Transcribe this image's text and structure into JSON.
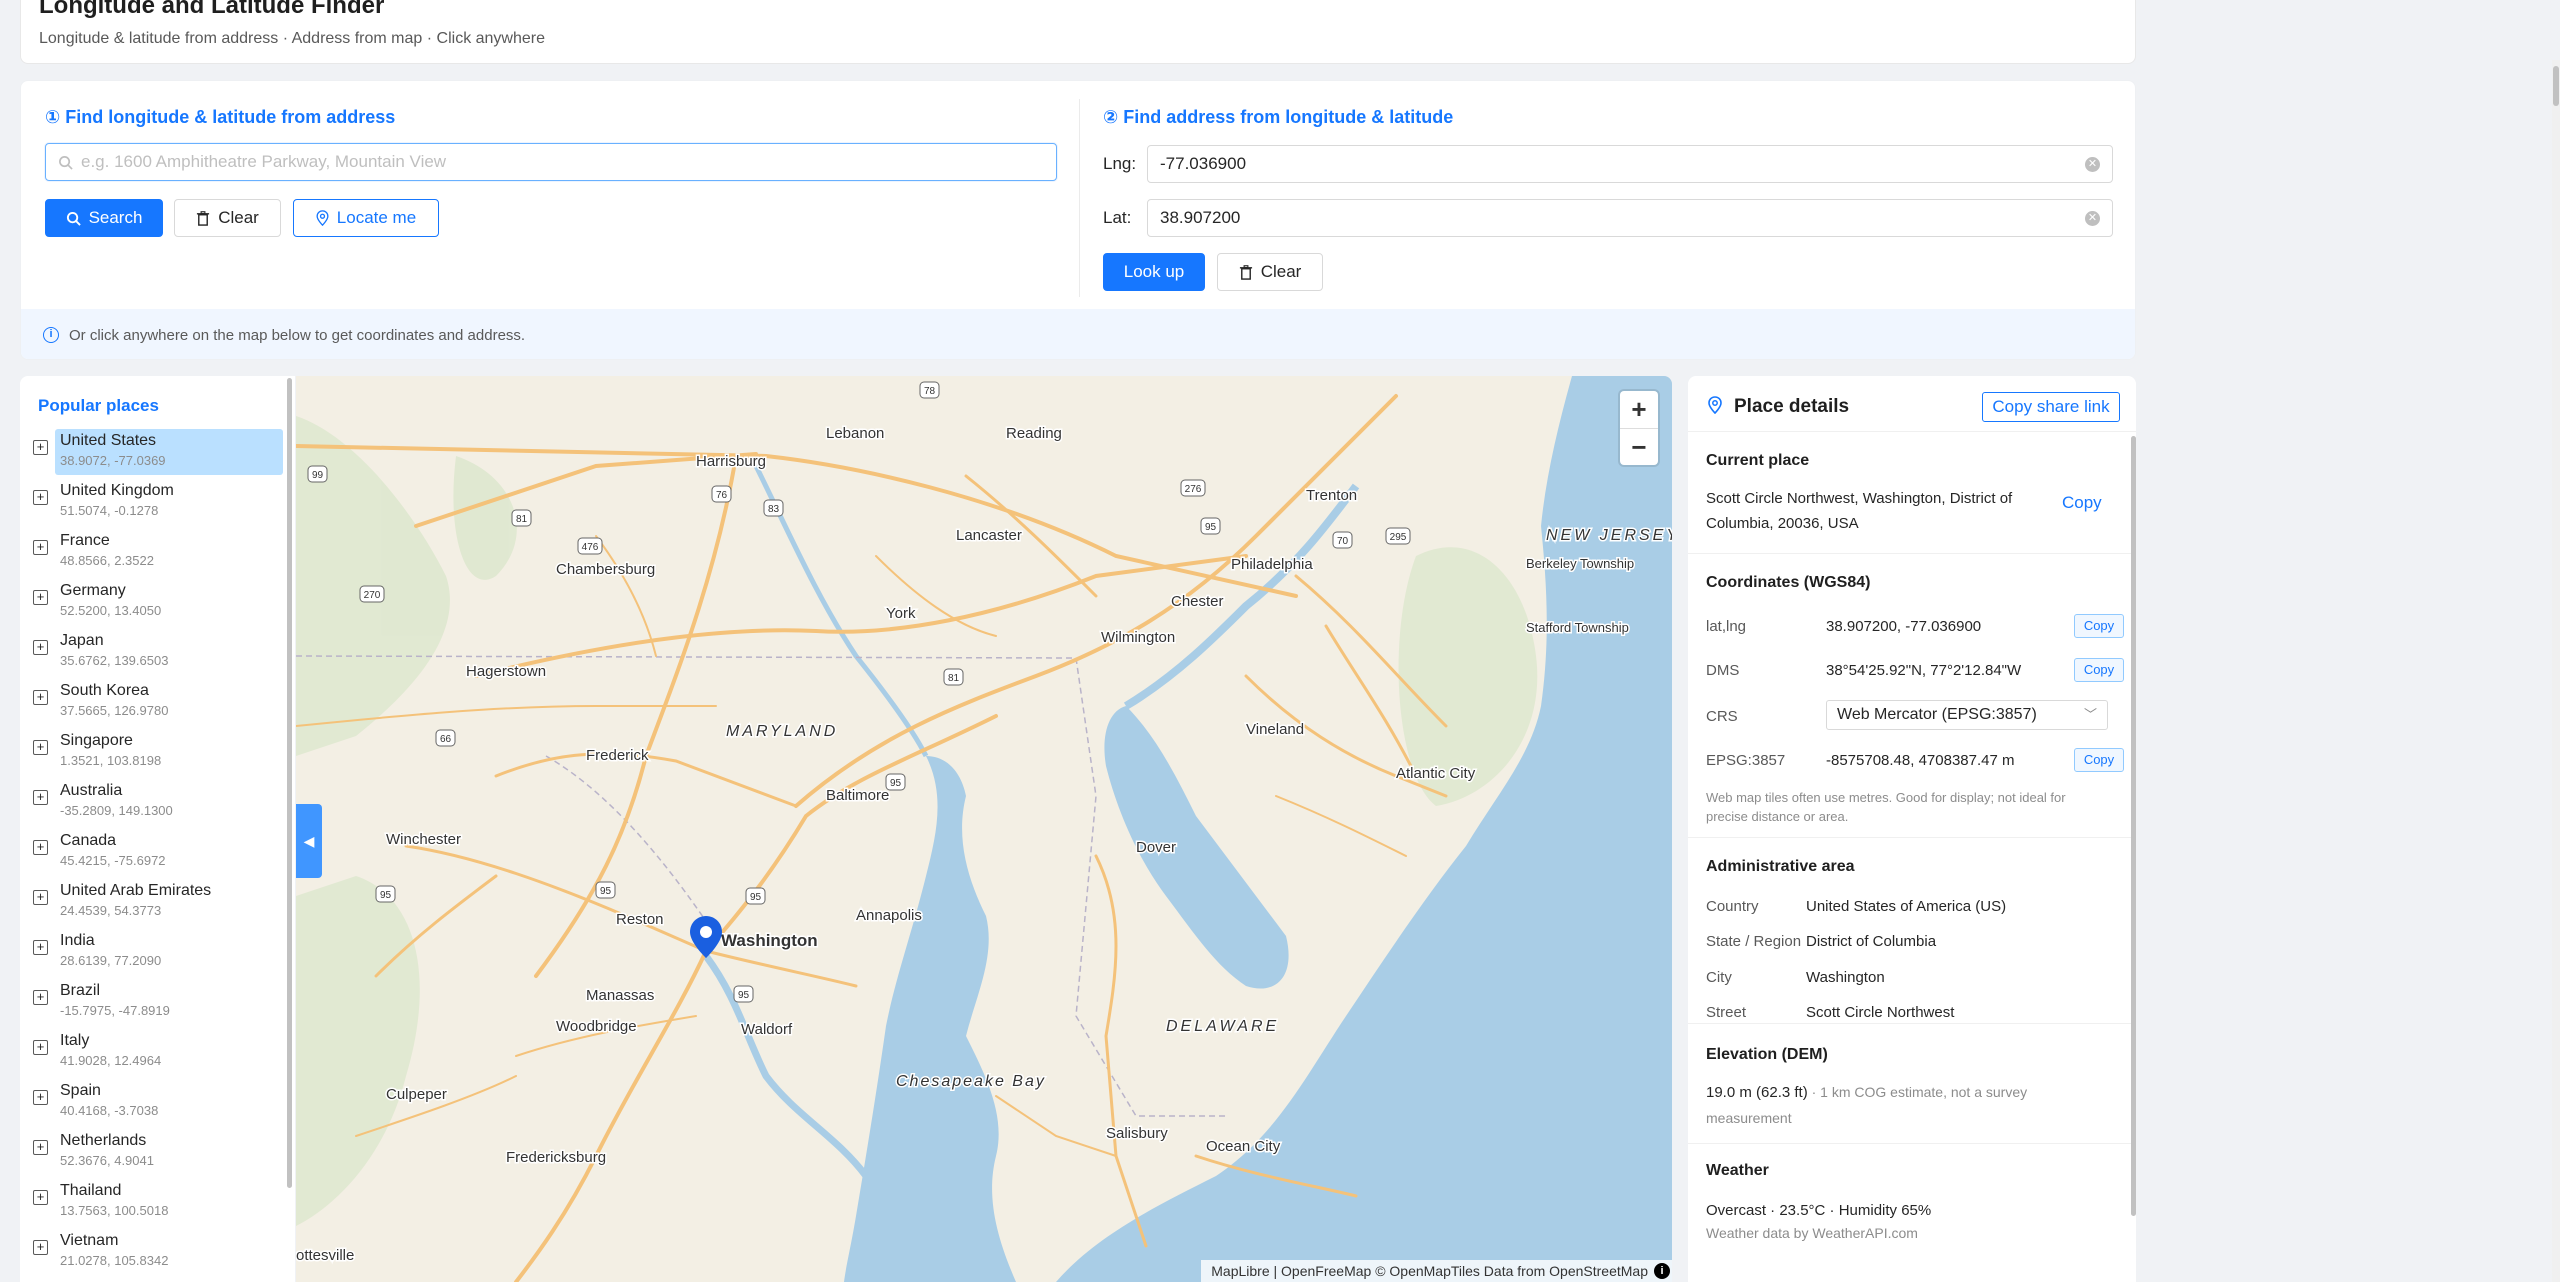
{
  "header": {
    "title": "Longitude and Latitude Finder",
    "subtitle": "Longitude & latitude from address · Address from map · Click anywhere"
  },
  "search": {
    "section1_title": "① Find longitude & latitude from address",
    "address_placeholder": "e.g. 1600 Amphitheatre Parkway, Mountain View",
    "search_label": "Search",
    "clear_label": "Clear",
    "locate_label": "Locate me",
    "section2_title": "② Find address from longitude & latitude",
    "lng_label": "Lng:",
    "lng_value": "-77.036900",
    "lat_label": "Lat:",
    "lat_value": "38.907200",
    "lookup_label": "Look up",
    "clear2_label": "Clear",
    "hint": "Or click anywhere on the map below to get coordinates and address."
  },
  "places": {
    "title": "Popular places",
    "items": [
      {
        "name": "United States",
        "coords": "38.9072, -77.0369",
        "selected": true
      },
      {
        "name": "United Kingdom",
        "coords": "51.5074, -0.1278"
      },
      {
        "name": "France",
        "coords": "48.8566, 2.3522"
      },
      {
        "name": "Germany",
        "coords": "52.5200, 13.4050"
      },
      {
        "name": "Japan",
        "coords": "35.6762, 139.6503"
      },
      {
        "name": "South Korea",
        "coords": "37.5665, 126.9780"
      },
      {
        "name": "Singapore",
        "coords": "1.3521, 103.8198"
      },
      {
        "name": "Australia",
        "coords": "-35.2809, 149.1300"
      },
      {
        "name": "Canada",
        "coords": "45.4215, -75.6972"
      },
      {
        "name": "United Arab Emirates",
        "coords": "24.4539, 54.3773"
      },
      {
        "name": "India",
        "coords": "28.6139, 77.2090"
      },
      {
        "name": "Brazil",
        "coords": "-15.7975, -47.8919"
      },
      {
        "name": "Italy",
        "coords": "41.9028, 12.4964"
      },
      {
        "name": "Spain",
        "coords": "40.4168, -3.7038"
      },
      {
        "name": "Netherlands",
        "coords": "52.3676, 4.9041"
      },
      {
        "name": "Thailand",
        "coords": "13.7563, 100.5018"
      },
      {
        "name": "Vietnam",
        "coords": "21.0278, 105.8342"
      }
    ]
  },
  "map": {
    "zoom_in": "+",
    "zoom_out": "−",
    "attribution": "MapLibre | OpenFreeMap © OpenMapTiles Data from OpenStreetMap",
    "attribution_icon": "i",
    "cities": [
      "Harrisburg",
      "Lebanon",
      "Reading",
      "Trenton",
      "Chambersburg",
      "Lancaster",
      "York",
      "NEW JERSEY",
      "Philadelphia",
      "Berkeley Township",
      "Chester",
      "Hagerstown",
      "Wilmington",
      "Stafford Township",
      "MARYLAND",
      "Frederick",
      "Vineland",
      "Baltimore",
      "Atlantic City",
      "Winchester",
      "Dover",
      "Reston",
      "Washington",
      "Annapolis",
      "Manassas",
      "Woodbridge",
      "Waldorf",
      "DELAWARE",
      "Chesapeake Bay",
      "Culpeper",
      "Salisbury",
      "Ocean City",
      "Fredericksburg",
      "ottesville"
    ],
    "shields": [
      "78",
      "99",
      "76",
      "83",
      "81",
      "476",
      "276",
      "95",
      "295",
      "70",
      "270",
      "66",
      "95",
      "95",
      "95",
      "95",
      "81",
      "95"
    ],
    "colors": {
      "land": "#f3efe4",
      "water": "#a9cde6",
      "road": "#f4c27a",
      "pin": "#1a5fe0"
    }
  },
  "details": {
    "title": "Place details",
    "share_label": "Copy share link",
    "current_place_title": "Current place",
    "address_line1": "Scott Circle Northwest, Washington, District of",
    "address_line2": "Columbia, 20036, USA",
    "copy_label": "Copy",
    "coords_title": "Coordinates (WGS84)",
    "latlng_label": "lat,lng",
    "latlng_value": "38.907200, -77.036900",
    "dms_label": "DMS",
    "dms_value": "38°54'25.92\"N, 77°2'12.84\"W",
    "crs_label": "CRS",
    "crs_value": "Web Mercator (EPSG:3857)",
    "epsg_label": "EPSG:3857",
    "epsg_value": "-8575708.48, 4708387.47 m",
    "epsg_note_1": "Web map tiles often use metres. Good for display; not ideal for",
    "epsg_note_2": "precise distance or area.",
    "admin_title": "Administrative area",
    "country_label": "Country",
    "country_value": "United States of America (US)",
    "state_label": "State / Region",
    "state_value": "District of Columbia",
    "city_label": "City",
    "city_value": "Washington",
    "street_label": "Street",
    "street_value": "Scott Circle Northwest",
    "elevation_title": "Elevation (DEM)",
    "elevation_value": "19.0 m (62.3 ft)",
    "elevation_note": " · 1 km COG estimate, not a survey",
    "elevation_note_2": "measurement",
    "weather_title": "Weather",
    "weather_value": "Overcast · 23.5°C · Humidity 65%",
    "weather_source": "Weather data by WeatherAPI.com"
  }
}
